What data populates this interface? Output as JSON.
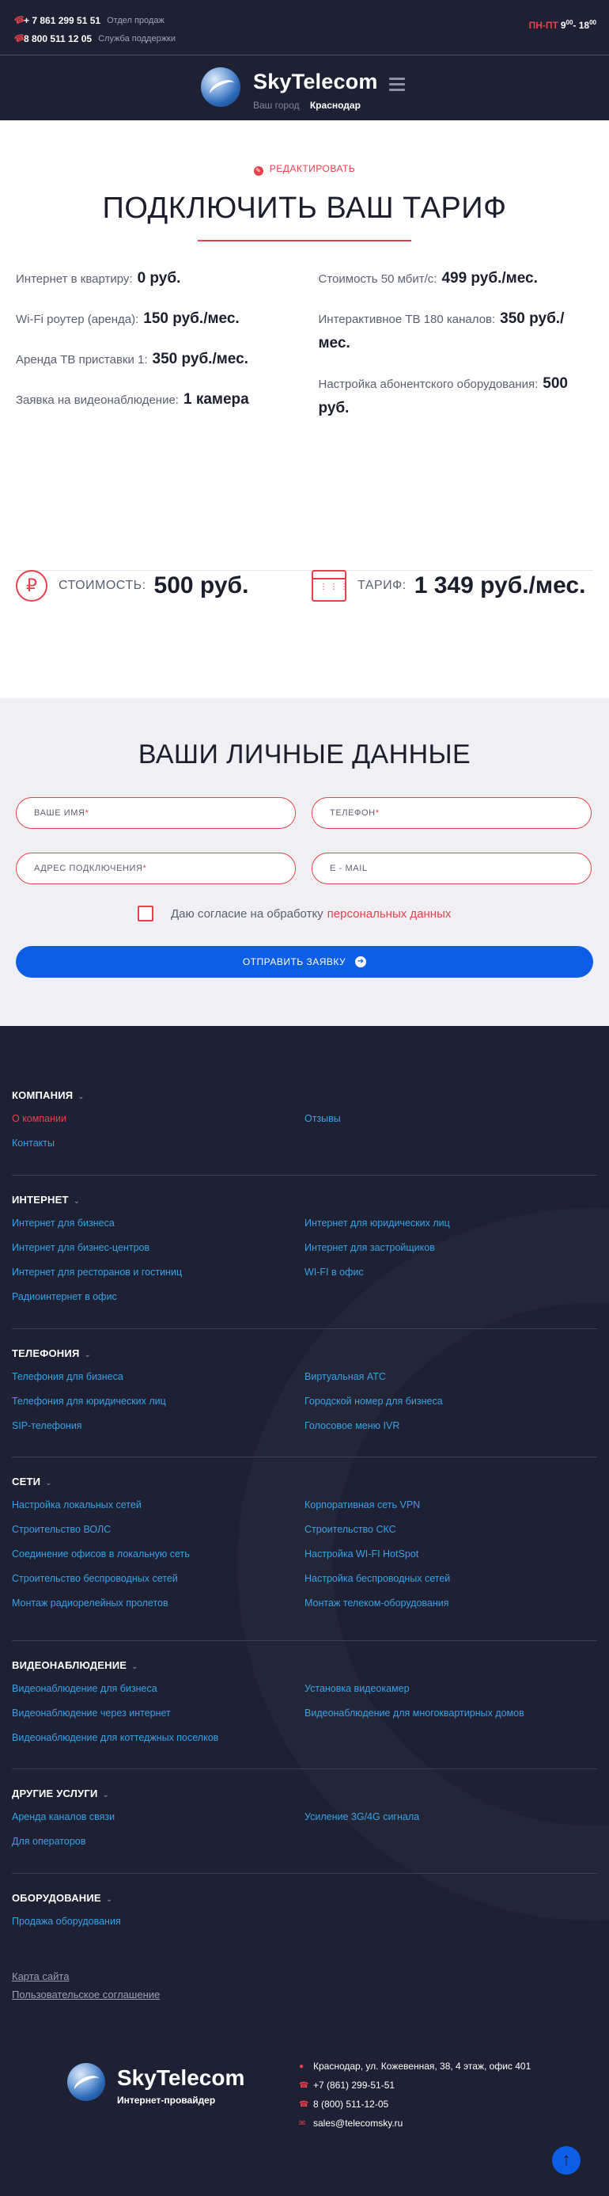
{
  "topbar": {
    "phones": [
      {
        "number": "+ 7 861 299 51 51",
        "note": "Отдел продаж"
      },
      {
        "number": "8 800 511 12 05",
        "note": "Служба поддержки"
      }
    ],
    "hours": {
      "days": "ПН-ПТ",
      "from": "9",
      "from_sup": "00",
      "sep": "- 18",
      "to_sup": "00"
    }
  },
  "header": {
    "brand": "SkyTelecom",
    "city_label": "Ваш город",
    "city_value": "Краснодар"
  },
  "tariff": {
    "edit_label": "РЕДАКТИРОВАТЬ",
    "title": "ПОДКЛЮЧИТЬ ВАШ ТАРИФ",
    "left": [
      {
        "label": "Интернет в квартиру:",
        "value": "0 руб."
      },
      {
        "label": "Wi-Fi роутер (аренда):",
        "value": "150 руб./мес."
      },
      {
        "label": "Аренда ТВ приставки 1:",
        "value": "350 руб./мес."
      },
      {
        "label": "Заявка на видеонаблюдение:",
        "value": "1 камера"
      }
    ],
    "right": [
      {
        "label": "Стоимость 50 мбит/с:",
        "value": "499 руб./мес."
      },
      {
        "label": "Интерактивное ТВ 180 каналов:",
        "value": "350 руб./мес."
      },
      {
        "label": "Настройка абонентского оборудования:",
        "value": "500 руб."
      }
    ],
    "cost_label": "СТОИМОСТЬ:",
    "cost_value": "500 руб.",
    "tariff_label": "ТАРИФ:",
    "tariff_value": "1 349 руб./мес."
  },
  "personal": {
    "title": "ВАШИ ЛИЧНЫЕ ДАННЫЕ",
    "fields": [
      {
        "label": "ВАШЕ ИМЯ",
        "required": "*"
      },
      {
        "label": "ТЕЛЕФОН",
        "required": "*"
      },
      {
        "label": "АДРЕС ПОДКЛЮЧЕНИЯ",
        "required": "*"
      },
      {
        "label": "E - MAIL",
        "required": ""
      }
    ],
    "consent_text": "Даю согласие на обработку",
    "consent_link": "персональных данных",
    "submit_label": "ОТПРАВИТЬ ЗАЯВКУ"
  },
  "footer": {
    "sections": [
      {
        "title": "КОМПАНИЯ",
        "links": [
          "О компании",
          "Отзывы",
          "Контакты"
        ]
      },
      {
        "title": "ИНТЕРНЕТ",
        "links": [
          "Интернет для бизнеса",
          "Интернет для юридических лиц",
          "Интернет для бизнес-центров",
          "Интернет для застройщиков",
          "Интернет для ресторанов и гостиниц",
          "WI-FI в офис",
          "Радиоинтернет в офис"
        ]
      },
      {
        "title": "ТЕЛЕФОНИЯ",
        "links": [
          "Телефония для бизнеса",
          "Виртуальная АТС",
          "Телефония для юридических лиц",
          "Городской номер для бизнеса",
          "SIP-телефония",
          "Голосовое меню IVR"
        ]
      },
      {
        "title": "СЕТИ",
        "links": [
          "Настройка локальных сетей",
          "Корпоративная сеть VPN",
          "Строительство ВОЛС",
          "Строительство СКС",
          "Соединение офисов в локальную сеть",
          "Настройка WI-FI HotSpot",
          "Строительство беспроводных сетей",
          "Настройка беспроводных сетей",
          "Монтаж радиорелейных пролетов",
          "Монтаж телеком-оборудования"
        ]
      },
      {
        "title": "ВИДЕОНАБЛЮДЕНИЕ",
        "links": [
          "Видеонаблюдение для бизнеса",
          "Установка видеокамер",
          "Видеонаблюдение через интернет",
          "Видеонаблюдение для многоквартирных домов",
          "Видеонаблюдение для коттеджных поселков"
        ]
      },
      {
        "title": "ДРУГИЕ УСЛУГИ",
        "links": [
          "Аренда каналов связи",
          "Усиление 3G/4G сигнала",
          "Для операторов"
        ]
      },
      {
        "title": "ОБОРУДОВАНИЕ",
        "links": [
          "Продажа оборудования"
        ]
      }
    ],
    "sitemap": "Карта сайта",
    "agreement": "Пользовательское соглашение",
    "brand": "SkyTelecom",
    "tagline": "Интернет-провайдер",
    "contacts": [
      {
        "icon": "location-icon",
        "text": "Краснодар, ул. Кожевенная, 38, 4 этаж, офис 401"
      },
      {
        "icon": "phone-icon",
        "text": "+7 (861) 299-51-51"
      },
      {
        "icon": "phone-icon",
        "text": "8 (800) 511-12-05"
      },
      {
        "icon": "mail-icon",
        "text": "sales@telecomsky.ru"
      }
    ]
  },
  "colors": {
    "accent": "#e8414c",
    "primary": "#0d5ee7",
    "dark": "#1e2133",
    "link": "#3aa1e6"
  }
}
